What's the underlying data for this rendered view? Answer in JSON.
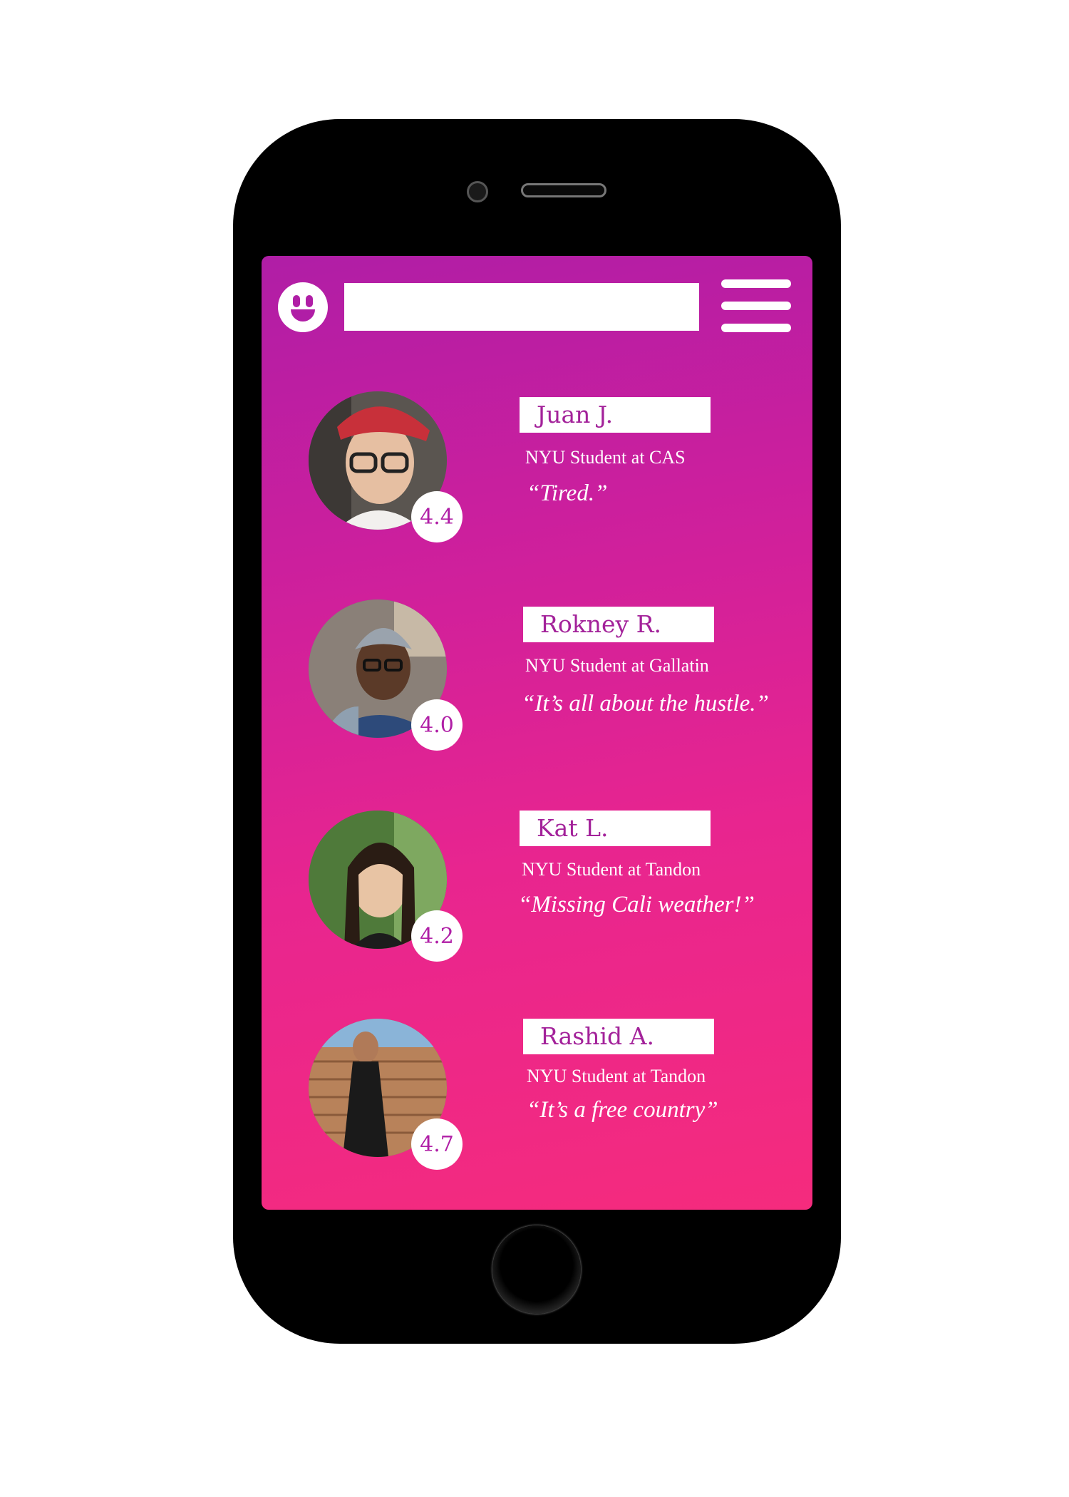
{
  "app": {
    "search": {
      "value": "",
      "placeholder": ""
    }
  },
  "profiles": [
    {
      "name": "Juan J.",
      "school": "NYU Student at CAS",
      "quote": "“Tired.”",
      "rating": "4.4"
    },
    {
      "name": "Rokney R.",
      "school": "NYU Student at Gallatin",
      "quote": "“It’s all about the hustle.”",
      "rating": "4.0"
    },
    {
      "name": "Kat L.",
      "school": "NYU Student at Tandon",
      "quote": "“Missing Cali weather!”",
      "rating": "4.2"
    },
    {
      "name": "Rashid A.",
      "school": "NYU Student at Tandon",
      "quote": "“It’s a free country”",
      "rating": "4.7"
    }
  ],
  "icons": {
    "logo": "smiley-face-icon",
    "menu": "hamburger-menu-icon"
  },
  "colors": {
    "gradient_top": "#b01ea6",
    "gradient_bottom": "#f52b7d",
    "name_text": "#a3229a",
    "rating_text": "#b01ea6"
  }
}
